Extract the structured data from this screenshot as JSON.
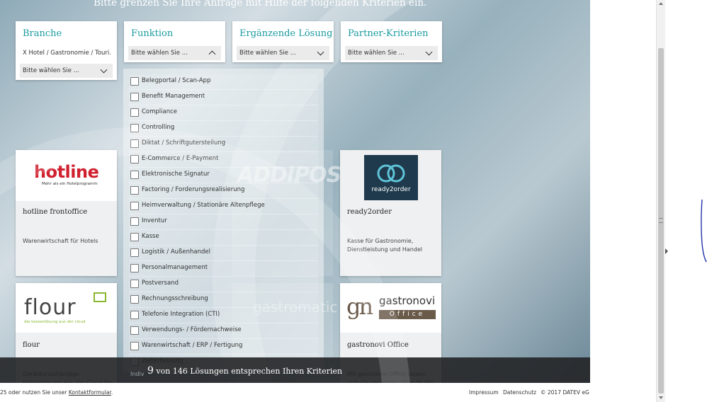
{
  "intro_text": "Bitte grenzen Sie Ihre Anfrage mit Hilfe der folgenden Kriterien ein.",
  "filters": {
    "branche": {
      "title": "Branche",
      "selected": "X  Hotel / Gastronomie / Touri...",
      "placeholder": "Bitte wählen Sie ..."
    },
    "funktion": {
      "title": "Funktion",
      "placeholder": "Bitte wählen Sie ..."
    },
    "ergaenzende": {
      "title": "Ergänzende Lösung",
      "placeholder": "Bitte wählen Sie ..."
    },
    "partner": {
      "title": "Partner-Kriterien",
      "placeholder": "Bitte wählen Sie ..."
    }
  },
  "funktion_options": [
    "Belegportal / Scan-App",
    "Benefit Management",
    "Compliance",
    "Controlling",
    "Diktat / Schriftgutersteilung",
    "E-Commerce / E-Payment",
    "Elektronische Signatur",
    "Factoring / Forderungsrealisierung",
    "Heimverwaltung / Stationäre Altenpflege",
    "Inventur",
    "Kasse",
    "Logistik / Außenhandel",
    "Personalmanagement",
    "Postversand",
    "Rechnungsschreibung",
    "Telefonie Integration (CTI)",
    "Verwendungs- / Fördernachweise",
    "Warenwirtschaft / ERP / Fertigung",
    "Zeiterfassung"
  ],
  "tiles": [
    {
      "logo_main": "hotline",
      "logo_sub": "Mehr als ein Hotelprogramm",
      "name": "hotline frontoffice",
      "desc": "Warenwirtschaft für Hotels"
    },
    {
      "logo_main": "ready2order",
      "name": "ready2order",
      "desc": "Kasse für Gastronomie, Dienstleistung und Handel"
    },
    {
      "logo_main": "flour",
      "logo_sub": "die kassenlösung aus der cloud",
      "name": "flour",
      "desc": "Geräteunabhängige Kassenlösung aus der Cloud für"
    },
    {
      "logo_main": "gastronovi",
      "logo_sub": "Office",
      "name": "gastronovi Office",
      "desc": "Mit gastronovi Office lassen sich die gesamten Abläufe der"
    }
  ],
  "ghost_texts": {
    "addipos": "ADDIPOS",
    "gastromatic": "gastromatic",
    "indiv": "Indiv"
  },
  "results": {
    "count": "9",
    "text": "von 146 Lösungen entsprechen Ihren Kriterien"
  },
  "footer": {
    "left_text": "25 oder nutzen Sie unser ",
    "contact_link": "Kontaktformular",
    "after_link": ".",
    "impressum": "Impressum",
    "datenschutz": "Datenschutz",
    "copyright": "© 2017 DATEV eG"
  },
  "colors": {
    "accent": "#1a9aa0",
    "hotline_red": "#d0202e",
    "ready2order_bg": "#1e3a4c",
    "flour_green": "#8ab833",
    "gastronovi_brown": "#6a5a4a"
  }
}
